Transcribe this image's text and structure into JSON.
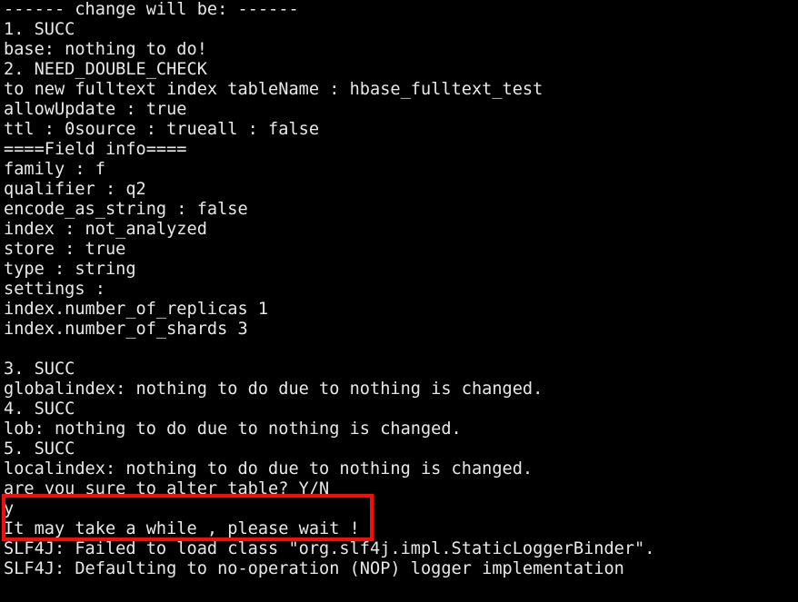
{
  "terminal": {
    "background_color": "#000000",
    "text_color": "#e8e8e8",
    "highlight_color": "#fb0a0a",
    "lines": [
      "------ change will be: ------",
      "1. SUCC",
      "base: nothing to do!",
      "2. NEED_DOUBLE_CHECK",
      "to new fulltext index tableName : hbase_fulltext_test",
      "allowUpdate : true",
      "ttl : 0source : trueall : false",
      "====Field info====",
      "family : f",
      "qualifier : q2",
      "encode_as_string : false",
      "index : not_analyzed",
      "store : true",
      "type : string",
      "settings :",
      "index.number_of_replicas 1",
      "index.number_of_shards 3",
      "",
      "3. SUCC",
      "globalindex: nothing to do due to nothing is changed.",
      "4. SUCC",
      "lob: nothing to do due to nothing is changed.",
      "5. SUCC",
      "localindex: nothing to do due to nothing is changed.",
      "are you sure to alter table? Y/N",
      "y",
      "It may take a while , please wait !",
      "SLF4J: Failed to load class \"org.slf4j.impl.StaticLoggerBinder\".",
      "SLF4J: Defaulting to no-operation (NOP) logger implementation"
    ],
    "prompt_question": "are you sure to alter table? Y/N",
    "user_answer": "y",
    "wait_message": "It may take a while , please wait !"
  }
}
